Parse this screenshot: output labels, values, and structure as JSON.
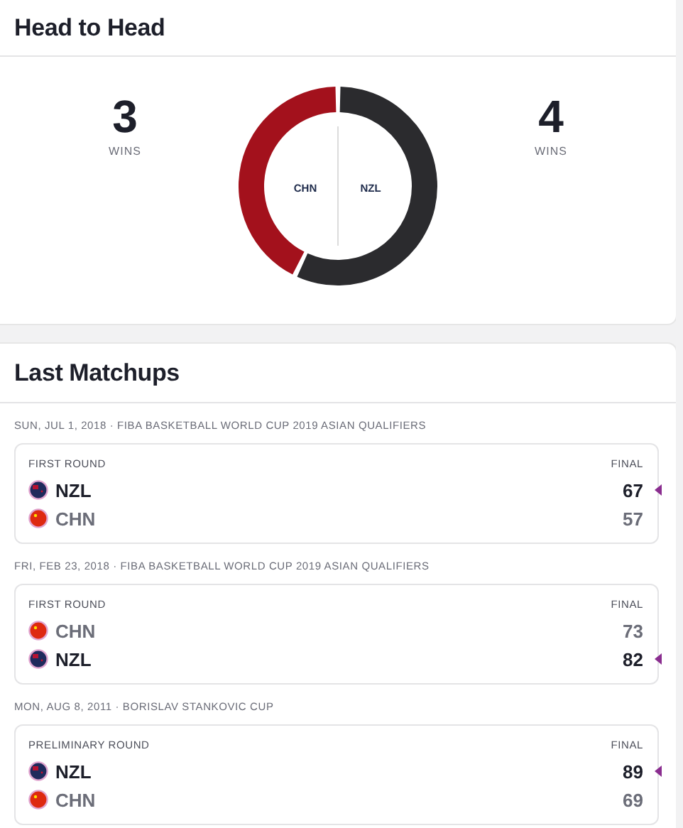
{
  "head_to_head": {
    "title": "Head to Head",
    "teams": [
      {
        "wins": "3",
        "label": "WINS"
      },
      {
        "wins": "4",
        "label": "WINS"
      }
    ],
    "chart_data": {
      "type": "donut",
      "categories": [
        "CHN",
        "NZL"
      ],
      "values": [
        42.86,
        57.14
      ],
      "colors": [
        "#a3111c",
        "#2b2b2e"
      ]
    }
  },
  "last_matchups": {
    "title": "Last Matchups",
    "games": [
      {
        "date": "SUN, JUL 1, 2018 · FIBA BASKETBALL WORLD CUP 2019 ASIAN QUALIFIERS",
        "round": "FIRST ROUND",
        "status": "FINAL",
        "teams": [
          {
            "kind": "new-zealand",
            "name": "NZL",
            "score": "67",
            "winner": true
          },
          {
            "kind": "china",
            "name": "CHN",
            "score": "57",
            "winner": false
          }
        ]
      },
      {
        "date": "FRI, FEB 23, 2018 · FIBA BASKETBALL WORLD CUP 2019 ASIAN QUALIFIERS",
        "round": "FIRST ROUND",
        "status": "FINAL",
        "teams": [
          {
            "kind": "china",
            "name": "CHN",
            "score": "73",
            "winner": false
          },
          {
            "kind": "new-zealand",
            "name": "NZL",
            "score": "82",
            "winner": true
          }
        ]
      },
      {
        "date": "MON, AUG 8, 2011 · BORISLAV STANKOVIC CUP",
        "round": "PRELIMINARY ROUND",
        "status": "FINAL",
        "teams": [
          {
            "kind": "new-zealand",
            "name": "NZL",
            "score": "89",
            "winner": true
          },
          {
            "kind": "china",
            "name": "CHN",
            "score": "69",
            "winner": false
          }
        ]
      }
    ]
  }
}
